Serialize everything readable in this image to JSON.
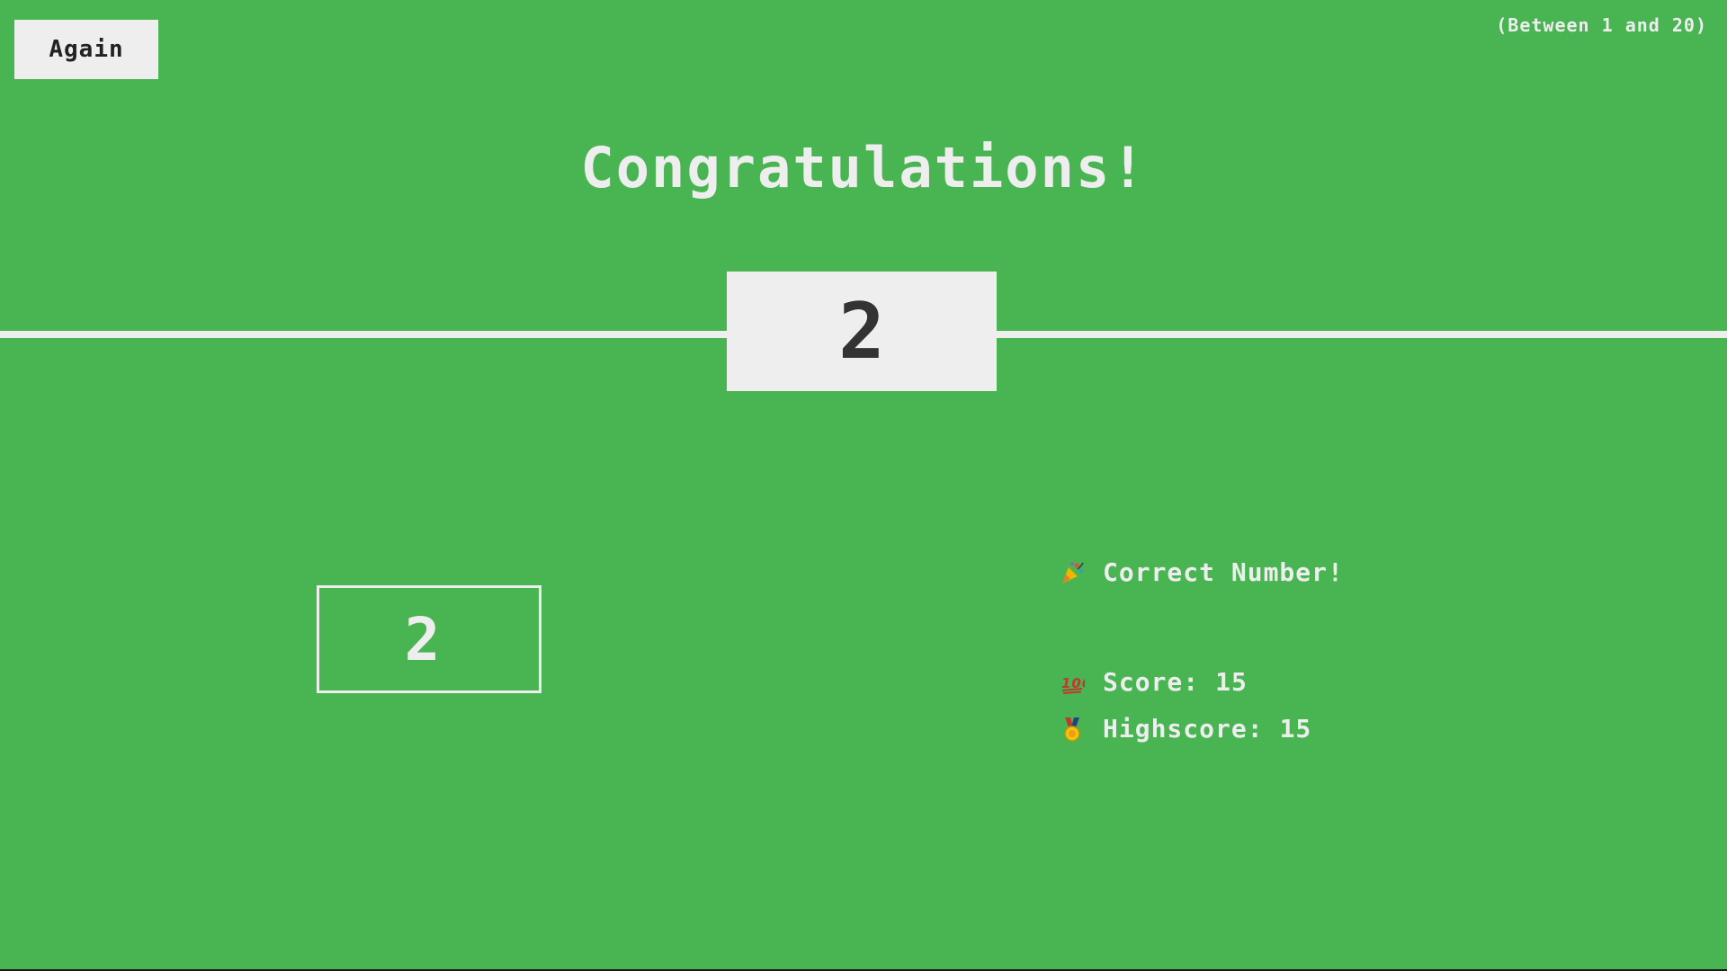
{
  "controls": {
    "again_label": "Again",
    "range_hint": "(Between 1 and 20)"
  },
  "main": {
    "title": "Congratulations!",
    "secret_number": "2",
    "guess_value": "2"
  },
  "status": {
    "message": "Correct Number!",
    "message_icon": "party-popper-icon",
    "score_label": "Score:",
    "score_value": "15",
    "score_icon": "hundred-points-icon",
    "highscore_label": "Highscore:",
    "highscore_value": "15",
    "highscore_icon": "medal-icon"
  },
  "colors": {
    "background": "#48b452",
    "foreground": "#eeeeee",
    "dark_text": "#333333"
  }
}
